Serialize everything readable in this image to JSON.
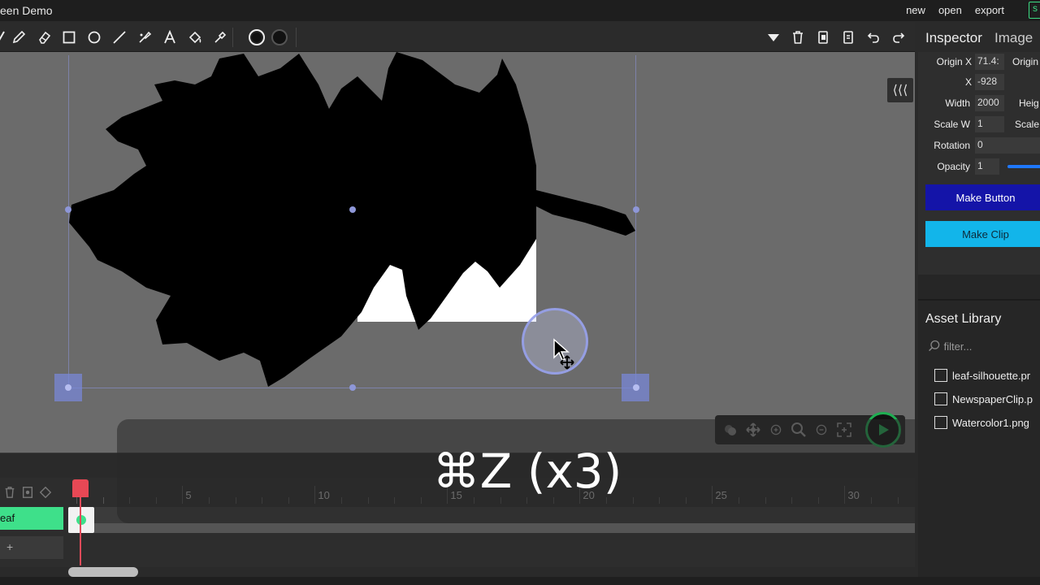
{
  "window": {
    "title": "een Demo"
  },
  "menu": {
    "new": "new",
    "open": "open",
    "export": "export",
    "share": "s"
  },
  "toolbar": {
    "tools": [
      "pencil-icon",
      "eraser-icon",
      "rectangle-icon",
      "ellipse-icon",
      "line-icon",
      "brush-icon",
      "text-icon",
      "fill-bucket-icon",
      "eyedropper-icon"
    ],
    "actions": [
      "dropdown-arrow-icon",
      "trash-icon",
      "copy-icon",
      "paste-icon",
      "undo-icon",
      "redo-icon"
    ]
  },
  "inspector": {
    "title": "Inspector",
    "subtitle": "Image",
    "origin_x_label": "Origin X",
    "origin_x_value": "71.4:",
    "origin_y_label": "Origin",
    "x_label": "X",
    "x_value": "-928",
    "width_label": "Width",
    "width_value": "2000",
    "height_label": "Heig",
    "scale_w_label": "Scale W",
    "scale_w_value": "1",
    "scale_h_label": "Scale",
    "rotation_label": "Rotation",
    "rotation_value": "0",
    "opacity_label": "Opacity",
    "opacity_value": "1",
    "make_button": "Make Button",
    "make_clip": "Make Clip"
  },
  "assets": {
    "title": "Asset Library",
    "filter_placeholder": "filter...",
    "items": [
      "leaf-silhouette.pr",
      "NewspaperClip.p",
      "Watercolor1.png"
    ]
  },
  "timeline": {
    "layer_name": "eaf",
    "add_layer": "+",
    "frame_numbers": [
      "5",
      "10",
      "15",
      "20",
      "25",
      "30"
    ]
  },
  "overlay": {
    "keystroke": "⌘Z (x3)"
  },
  "colors": {
    "accent_green": "#3ee08a",
    "make_button_bg": "#1414a8",
    "make_clip_bg": "#12b5ea",
    "playhead": "#e84855",
    "canvas_bg": "#6b6b6b"
  }
}
